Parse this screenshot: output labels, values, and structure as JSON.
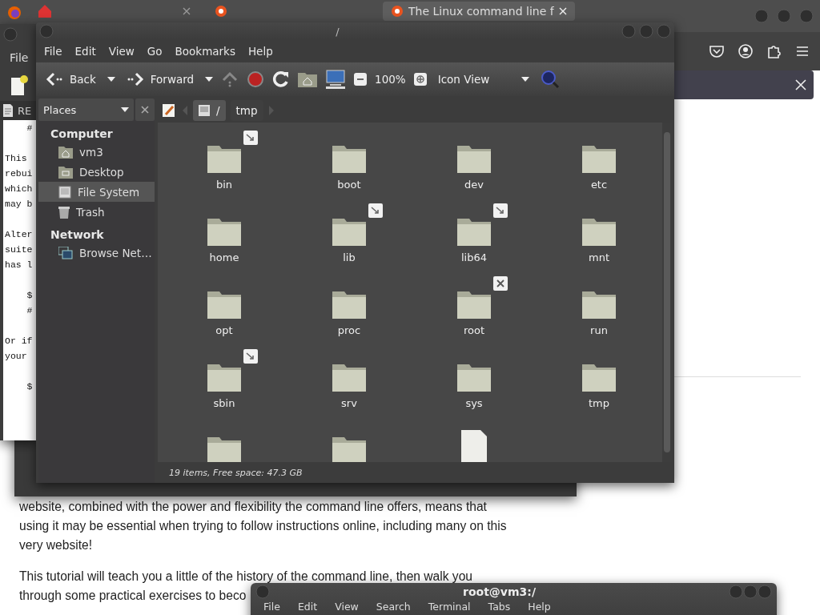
{
  "browser": {
    "tabs": [
      {
        "title": "The Linux command line f",
        "selected": true
      }
    ],
    "article": {
      "paragraphs": [
        [
          "website, combined with the power and flexibility the command line offers, means that",
          "using it may be essential when trying to follow instructions online, including many on this",
          "very website!"
        ],
        [
          "This tutorial will teach you a little of the history of the command line, then walk you",
          "through some practical exercises to beco"
        ]
      ]
    }
  },
  "editor": {
    "menu": [
      "File"
    ],
    "tab": "RE",
    "paragraphs": [
      [
        "    #"
      ],
      [
        "This",
        "rebui",
        "which",
        "may b"
      ],
      [
        "Alter",
        "suite",
        "has l"
      ],
      [
        "    $",
        "    #"
      ],
      [
        "Or if",
        "your"
      ],
      [
        "    $"
      ]
    ]
  },
  "file_manager": {
    "title": "/",
    "menu": [
      "File",
      "Edit",
      "View",
      "Go",
      "Bookmarks",
      "Help"
    ],
    "toolbar": {
      "back": "Back",
      "forward": "Forward",
      "zoom": "100%",
      "view": "Icon View"
    },
    "sidebar": {
      "dropdown": "Places",
      "sections": [
        {
          "heading": "Computer",
          "items": [
            {
              "label": "vm3",
              "kind": "home",
              "selected": false
            },
            {
              "label": "Desktop",
              "kind": "desktop",
              "selected": false
            },
            {
              "label": "File System",
              "kind": "drive",
              "selected": true
            },
            {
              "label": "Trash",
              "kind": "trash",
              "selected": false
            }
          ]
        },
        {
          "heading": "Network",
          "items": [
            {
              "label": "Browse Net…",
              "kind": "network",
              "selected": false
            }
          ]
        }
      ]
    },
    "path": [
      {
        "label": "/",
        "kind": "root",
        "selected": true
      },
      {
        "label": "tmp",
        "kind": "folder",
        "selected": false
      }
    ],
    "items": [
      {
        "name": "bin",
        "kind": "folder",
        "symlink": true,
        "no_access": false
      },
      {
        "name": "boot",
        "kind": "folder",
        "symlink": false,
        "no_access": false
      },
      {
        "name": "dev",
        "kind": "folder",
        "symlink": false,
        "no_access": false
      },
      {
        "name": "etc",
        "kind": "folder",
        "symlink": false,
        "no_access": false
      },
      {
        "name": "home",
        "kind": "folder",
        "symlink": false,
        "no_access": false
      },
      {
        "name": "lib",
        "kind": "folder",
        "symlink": true,
        "no_access": false
      },
      {
        "name": "lib64",
        "kind": "folder",
        "symlink": true,
        "no_access": false
      },
      {
        "name": "mnt",
        "kind": "folder",
        "symlink": false,
        "no_access": false
      },
      {
        "name": "opt",
        "kind": "folder",
        "symlink": false,
        "no_access": false
      },
      {
        "name": "proc",
        "kind": "folder",
        "symlink": false,
        "no_access": false
      },
      {
        "name": "root",
        "kind": "folder",
        "symlink": false,
        "no_access": true
      },
      {
        "name": "run",
        "kind": "folder",
        "symlink": false,
        "no_access": false
      },
      {
        "name": "sbin",
        "kind": "folder",
        "symlink": true,
        "no_access": false
      },
      {
        "name": "srv",
        "kind": "folder",
        "symlink": false,
        "no_access": false
      },
      {
        "name": "sys",
        "kind": "folder",
        "symlink": false,
        "no_access": false
      },
      {
        "name": "tmp",
        "kind": "folder",
        "symlink": false,
        "no_access": false
      },
      {
        "kind": "folder",
        "symlink": false,
        "no_access": false
      },
      {
        "kind": "folder",
        "symlink": false,
        "no_access": false
      },
      {
        "kind": "file",
        "symlink": false,
        "no_access": false
      }
    ],
    "status": "19 items, Free space: 47.3 GB"
  },
  "terminal": {
    "title": "root@vm3:/",
    "menu": [
      "File",
      "Edit",
      "View",
      "Search",
      "Terminal",
      "Tabs",
      "Help"
    ]
  }
}
